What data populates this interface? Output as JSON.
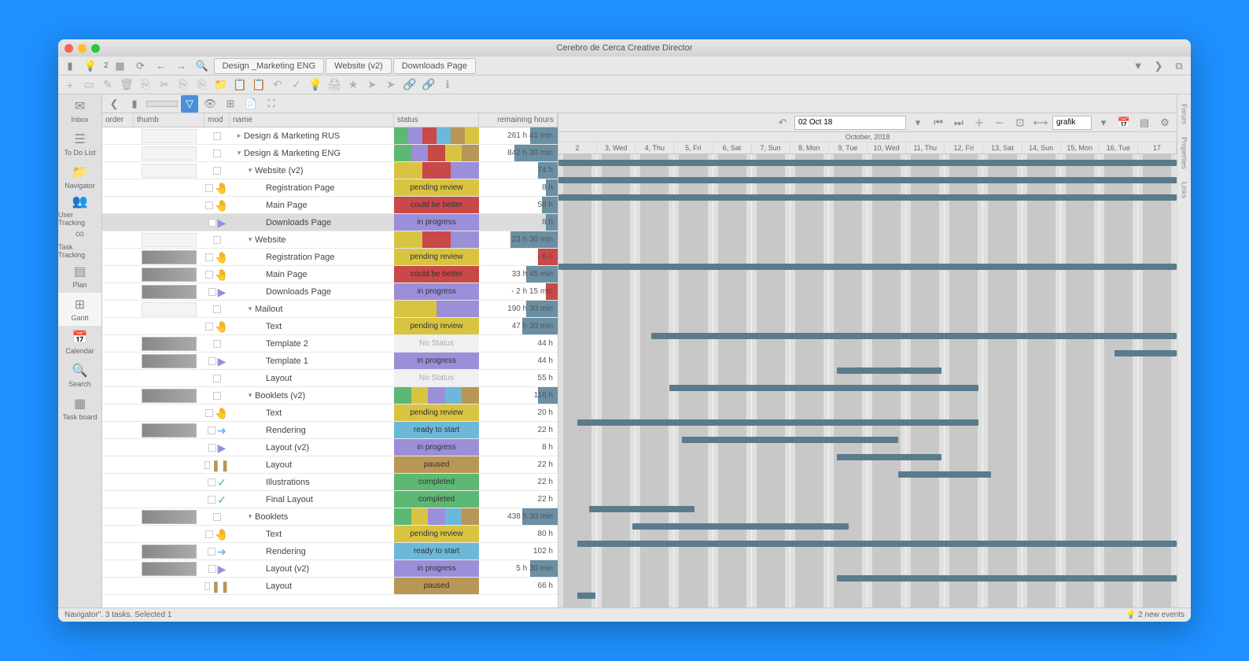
{
  "title": "Cerebro de Cerca   Creative Director",
  "breadcrumbs": [
    "Design _Marketing ENG",
    "Website (v2)",
    "Downloads Page"
  ],
  "notif_count": "2",
  "leftNav": [
    {
      "icon": "✉",
      "label": "Inbox"
    },
    {
      "icon": "☰",
      "label": "To Do List"
    },
    {
      "icon": "📁",
      "label": "Navigator"
    },
    {
      "icon": "👥",
      "label": "User Tracking"
    },
    {
      "icon": "∞",
      "label": "Task Tracking"
    },
    {
      "icon": "▤",
      "label": "Plan"
    },
    {
      "icon": "⊞",
      "label": "Gantt"
    },
    {
      "icon": "📅",
      "label": "Calendar"
    },
    {
      "icon": "🔍",
      "label": "Search"
    },
    {
      "icon": "▦",
      "label": "Task board"
    }
  ],
  "rightTabs": [
    "Forum",
    "Properties",
    "Links"
  ],
  "columns": {
    "order": "order",
    "thumb": "thumb",
    "mod": "mod",
    "name": "name",
    "status": "status",
    "hours": "remaining hours"
  },
  "gantt": {
    "date_input": "02 Oct 18",
    "month": "October, 2018",
    "view": "grafik",
    "days": [
      "2",
      "3, Wed",
      "4, Thu",
      "5, Fri",
      "6, Sat",
      "7, Sun",
      "8, Mon",
      "9, Tue",
      "10, Wed",
      "11, Thu",
      "12, Fri",
      "13, Sat",
      "14, Sun",
      "15, Mon",
      "16, Tue",
      "17"
    ]
  },
  "statuses": {
    "pending": "pending review",
    "better": "could be better",
    "progress": "in progress",
    "nostatus": "No Status",
    "ready": "ready to start",
    "paused": "paused",
    "completed": "completed"
  },
  "statusColors": {
    "pending": "#d9c441",
    "better": "#c94848",
    "progress": "#9b8fd9",
    "nostatus": "#f0f0f0",
    "ready": "#6cb8d9",
    "paused": "#b89656",
    "completed": "#5cb873"
  },
  "rows": [
    {
      "depth": 0,
      "exp": "▸",
      "name": "Design & Marketing RUS",
      "segs": [
        "#5cb873",
        "#9b8fd9",
        "#c94848",
        "#6cb8d9",
        "#b89656",
        "#d9c441"
      ],
      "hours": "261 h 41 min",
      "hbar": 35,
      "thumb": "p",
      "bar": [
        0,
        100
      ]
    },
    {
      "depth": 0,
      "exp": "▾",
      "name": "Design & Marketing ENG",
      "segs": [
        "#5cb873",
        "#9b8fd9",
        "#c94848",
        "#d9c441",
        "#b89656"
      ],
      "hours": "842 h 30 min",
      "hbar": 55,
      "thumb": "p",
      "bar": [
        0,
        100
      ]
    },
    {
      "depth": 1,
      "exp": "▾",
      "name": "Website (v2)",
      "segs": [
        "#d9c441",
        "#c94848",
        "#9b8fd9"
      ],
      "hours": "74 h",
      "hbar": 25,
      "thumb": "p",
      "bar": [
        0,
        100
      ]
    },
    {
      "depth": 2,
      "mod": "🤚",
      "modc": "#d9c441",
      "name": "Registration Page",
      "status": "pending",
      "hours": "8 h",
      "hbar": 15
    },
    {
      "depth": 2,
      "mod": "🤚",
      "modc": "#c94848",
      "name": "Main Page",
      "status": "better",
      "hours": "58 h",
      "hbar": 20
    },
    {
      "depth": 2,
      "mod": "▶",
      "modc": "#9b8fd9",
      "name": "Downloads Page",
      "status": "progress",
      "hours": "8 h",
      "hbar": 15,
      "selected": true
    },
    {
      "depth": 1,
      "exp": "▾",
      "name": "Website",
      "segs": [
        "#d9c441",
        "#c94848",
        "#9b8fd9"
      ],
      "hours": "23 h 30 min",
      "hbar": 60,
      "thumb": "p",
      "bar": [
        0,
        100
      ]
    },
    {
      "depth": 2,
      "mod": "🤚",
      "modc": "#d9c441",
      "name": "Registration Page",
      "status": "pending",
      "hours": "- 8 h",
      "hbar": 25,
      "hred": true,
      "thumb": "i"
    },
    {
      "depth": 2,
      "mod": "🤚",
      "modc": "#c94848",
      "name": "Main Page",
      "status": "better",
      "hours": "33 h 45 min",
      "hbar": 40,
      "thumb": "i"
    },
    {
      "depth": 2,
      "mod": "▶",
      "modc": "#9b8fd9",
      "name": "Downloads Page",
      "status": "progress",
      "hours": "- 2 h 15 min",
      "hbar": 15,
      "hred": true,
      "thumb": "i"
    },
    {
      "depth": 1,
      "exp": "▾",
      "name": "Mailout",
      "segs": [
        "#d9c441",
        "#9b8fd9"
      ],
      "hours": "190 h 30 min",
      "hbar": 40,
      "thumb": "p",
      "bar": [
        15,
        100
      ]
    },
    {
      "depth": 2,
      "mod": "🤚",
      "modc": "#d9c441",
      "name": "Text",
      "status": "pending",
      "hours": "47 h 30 min",
      "hbar": 45,
      "bar": [
        90,
        100
      ]
    },
    {
      "depth": 2,
      "name": "Template 2",
      "status": "nostatus",
      "hours": "44 h",
      "hbar": 0,
      "thumb": "i",
      "bar": [
        45,
        62
      ]
    },
    {
      "depth": 2,
      "mod": "▶",
      "modc": "#9b8fd9",
      "name": "Template 1",
      "status": "progress",
      "hours": "44 h",
      "hbar": 0,
      "thumb": "i",
      "bar": [
        18,
        68
      ]
    },
    {
      "depth": 2,
      "name": "Layout",
      "status": "nostatus",
      "hours": "55 h",
      "hbar": 0
    },
    {
      "depth": 1,
      "exp": "▾",
      "name": "Booklets (v2)",
      "segs": [
        "#5cb873",
        "#d9c441",
        "#9b8fd9",
        "#6cb8d9",
        "#b89656"
      ],
      "hours": "116 h",
      "hbar": 25,
      "thumb": "i",
      "bar": [
        3,
        68
      ]
    },
    {
      "depth": 2,
      "mod": "🤚",
      "modc": "#d9c441",
      "name": "Text",
      "status": "pending",
      "hours": "20 h",
      "hbar": 0,
      "bar": [
        20,
        55
      ]
    },
    {
      "depth": 2,
      "mod": "➜",
      "modc": "#6cb8d9",
      "name": "Rendering",
      "status": "ready",
      "hours": "22 h",
      "hbar": 0,
      "thumb": "i",
      "bar": [
        45,
        62
      ]
    },
    {
      "depth": 2,
      "mod": "▶",
      "modc": "#9b8fd9",
      "name": "Layout (v2)",
      "status": "progress",
      "hours": "8 h",
      "hbar": 0,
      "bar": [
        55,
        70
      ]
    },
    {
      "depth": 2,
      "mod": "❚❚",
      "modc": "#b89656",
      "name": "Layout",
      "status": "paused",
      "hours": "22 h",
      "hbar": 0
    },
    {
      "depth": 2,
      "mod": "✓",
      "modc": "#5cb873",
      "name": "Illustrations",
      "status": "completed",
      "hours": "22 h",
      "hbar": 0,
      "bar": [
        5,
        22
      ]
    },
    {
      "depth": 2,
      "mod": "✓",
      "modc": "#5cb873",
      "name": "Final Layout",
      "status": "completed",
      "hours": "22 h",
      "hbar": 0,
      "bar": [
        12,
        47
      ]
    },
    {
      "depth": 1,
      "exp": "▾",
      "name": "Booklets",
      "segs": [
        "#5cb873",
        "#d9c441",
        "#9b8fd9",
        "#6cb8d9",
        "#b89656"
      ],
      "hours": "438 h 30 min",
      "hbar": 45,
      "thumb": "i",
      "bar": [
        3,
        100
      ]
    },
    {
      "depth": 2,
      "mod": "🤚",
      "modc": "#d9c441",
      "name": "Text",
      "status": "pending",
      "hours": "80 h",
      "hbar": 0
    },
    {
      "depth": 2,
      "mod": "➜",
      "modc": "#6cb8d9",
      "name": "Rendering",
      "status": "ready",
      "hours": "102 h",
      "hbar": 0,
      "thumb": "i",
      "bar": [
        45,
        100
      ]
    },
    {
      "depth": 2,
      "mod": "▶",
      "modc": "#9b8fd9",
      "name": "Layout (v2)",
      "status": "progress",
      "hours": "5 h 30 min",
      "hbar": 35,
      "thumb": "i",
      "bar": [
        3,
        6
      ]
    },
    {
      "depth": 2,
      "mod": "❚❚",
      "modc": "#b89656",
      "name": "Layout",
      "status": "paused",
      "hours": "66 h",
      "hbar": 0
    }
  ],
  "statusbar": {
    "left": "Navigator\". 3 tasks. Selected 1",
    "right": "2 new events"
  }
}
